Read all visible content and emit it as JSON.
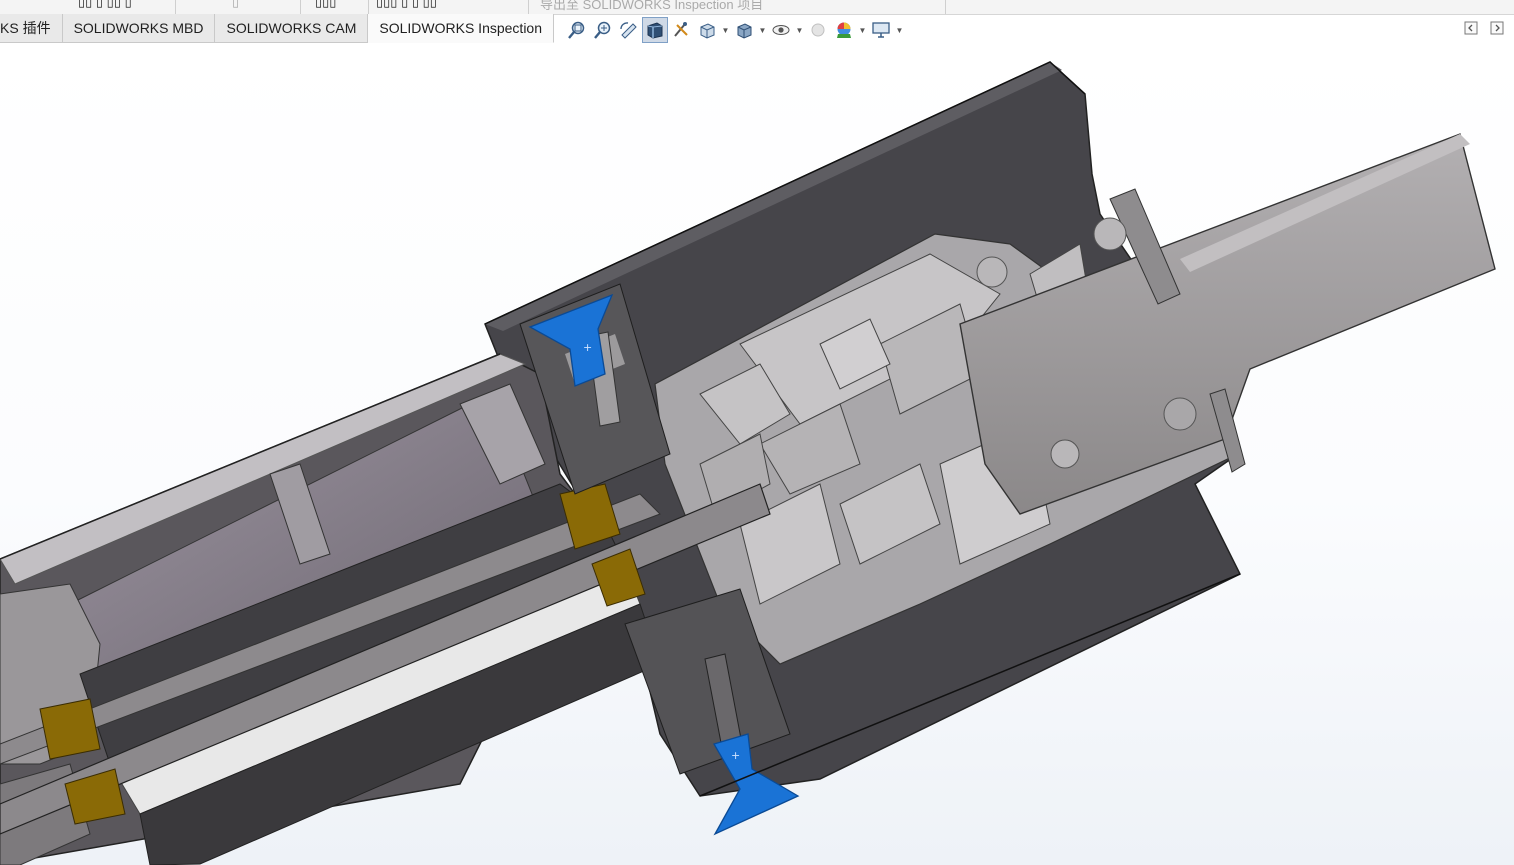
{
  "top_strip": {
    "cut_texts": [
      "...KS 插件...",
      "...",
      "...",
      "...",
      "..."
    ],
    "hint": "导出至 SOLIDWORKS Inspection 项目"
  },
  "tabs": [
    {
      "label": "KS 插件",
      "active": false
    },
    {
      "label": "SOLIDWORKS MBD",
      "active": false
    },
    {
      "label": "SOLIDWORKS CAM",
      "active": false
    },
    {
      "label": "SOLIDWORKS Inspection",
      "active": true
    }
  ],
  "toolbar": {
    "icons": [
      "zoom-to-fit-icon",
      "zoom-to-area-icon",
      "previous-view-icon",
      "section-view-icon",
      "dynamic-annotation-icon",
      "view-orientation-icon",
      "display-style-icon",
      "hide-show-items-icon",
      "edit-appearance-icon",
      "apply-scene-icon",
      "view-settings-icon"
    ]
  },
  "colors": {
    "tab_bg": "#e9e9e9",
    "tab_active_bg": "#fafafa",
    "dark_housing": "#46454a",
    "section_grey": "#a8a6aa",
    "cut_face_light": "#c9c7c9",
    "shaft": "#9d9a9b",
    "highlight_blue": "#1a73d6",
    "bronze": "#8a6a06"
  }
}
